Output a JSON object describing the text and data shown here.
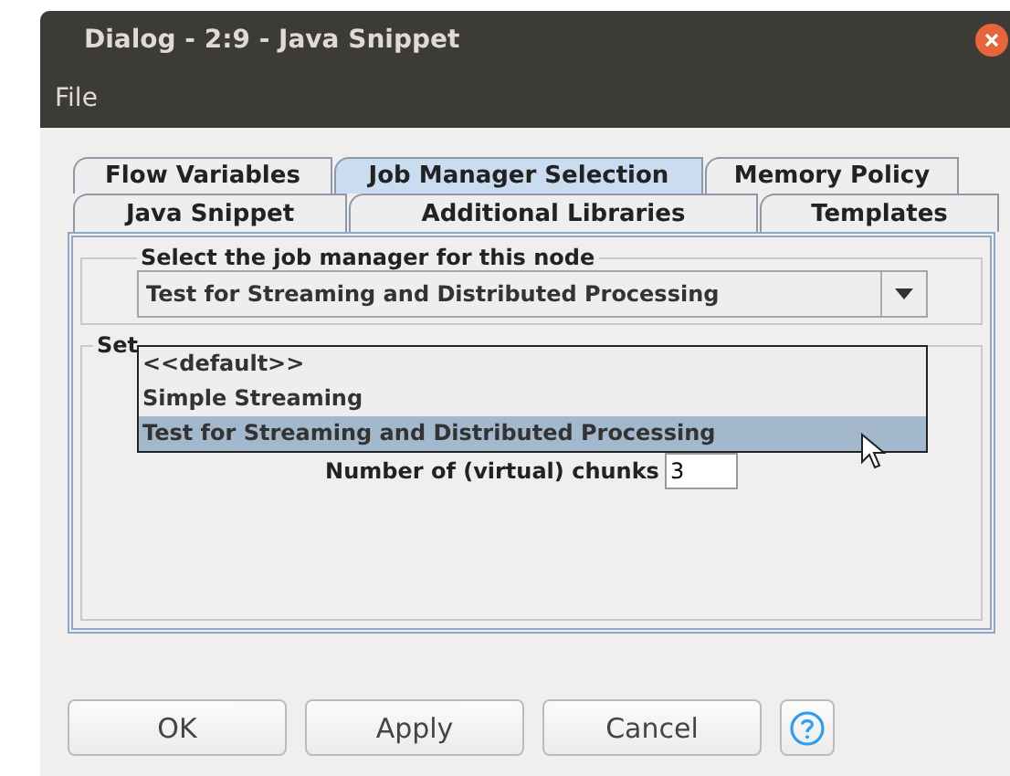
{
  "window": {
    "title": "Dialog - 2:9 - Java Snippet"
  },
  "menu": [
    "File"
  ],
  "tab_rows": [
    [
      {
        "label": "Flow Variables",
        "selected": false
      },
      {
        "label": "Job Manager Selection",
        "selected": true
      },
      {
        "label": "Memory Policy",
        "selected": false
      }
    ],
    [
      {
        "label": "Java Snippet",
        "selected": false
      },
      {
        "label": "Additional Libraries",
        "selected": false
      },
      {
        "label": "Templates",
        "selected": false
      }
    ]
  ],
  "job_manager_group": {
    "title": "Select the job manager for this node",
    "value": "Test for Streaming and Distributed Processing",
    "options": [
      {
        "label": "<<default>>",
        "selected": false
      },
      {
        "label": "Simple Streaming",
        "selected": false
      },
      {
        "label": "Test for Streaming and Distributed Processing",
        "selected": true
      }
    ]
  },
  "settings_group": {
    "title": "Set",
    "chunks_label": "Number of (virtual) chunks",
    "chunks_value": "3"
  },
  "buttons": [
    "OK",
    "Apply",
    "Cancel"
  ]
}
